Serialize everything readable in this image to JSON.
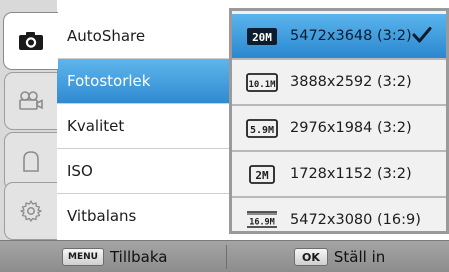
{
  "tabs": [
    {
      "icon": "camera-icon"
    },
    {
      "icon": "video-camera-icon"
    },
    {
      "icon": "person-icon"
    },
    {
      "icon": "gear-icon"
    }
  ],
  "menu": {
    "items": [
      "AutoShare",
      "Fotostorlek",
      "Kvalitet",
      "ISO",
      "Vitbalans"
    ],
    "selected_index": 1
  },
  "dropdown": {
    "options": [
      {
        "badge": "20M",
        "label": "5472x3648 (3:2)",
        "checked": true
      },
      {
        "badge": "10.1M",
        "label": "3888x2592 (3:2)",
        "checked": false
      },
      {
        "badge": "5.9M",
        "label": "2976x1984 (3:2)",
        "checked": false
      },
      {
        "badge": "2M",
        "label": "1728x1152 (3:2)",
        "checked": false
      },
      {
        "badge": "16.9M",
        "label": "5472x3080 (16:9)",
        "checked": false
      }
    ]
  },
  "bottom": {
    "back_key": "MENU",
    "back_label": "Tillbaka",
    "ok_key": "OK",
    "ok_label": "Ställ in"
  },
  "colors": {
    "selection_blue": "#3a95d8",
    "panel_border": "#9a9a9a",
    "bottom_bar": "#999999"
  }
}
